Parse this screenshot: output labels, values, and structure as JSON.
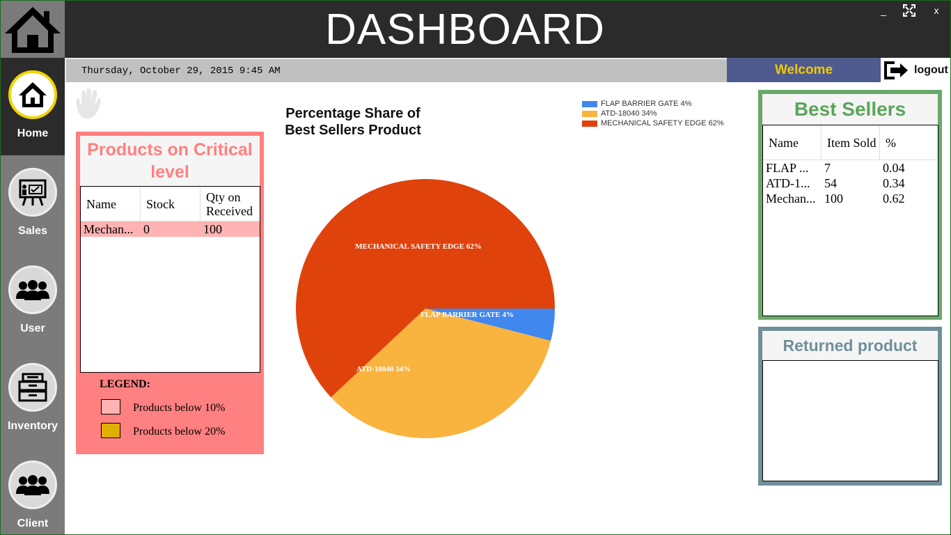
{
  "window": {
    "title": "DASHBOARD",
    "minimize_label": "_",
    "close_label": "x"
  },
  "datetime": "Thursday, October 29, 2015 9:45 AM",
  "welcome": "Welcome",
  "logout_label": "logout",
  "sidebar": {
    "items": [
      {
        "label": "Home",
        "icon": "home-icon"
      },
      {
        "label": "Sales",
        "icon": "sales-board-icon"
      },
      {
        "label": "User",
        "icon": "users-icon"
      },
      {
        "label": "Inventory",
        "icon": "inventory-cabinet-icon"
      },
      {
        "label": "Client",
        "icon": "clients-icon"
      }
    ]
  },
  "critical": {
    "title": "Products on Critical level",
    "columns": [
      "Name",
      "Stock",
      "Qty on Received"
    ],
    "rows": [
      {
        "name": "Mechan...",
        "stock": "0",
        "qty": "100"
      }
    ],
    "legend_title": "LEGEND:",
    "legend": [
      {
        "label": "Products below 10%",
        "color": "#ffb3b3"
      },
      {
        "label": "Products below 20%",
        "color": "#e0b000"
      }
    ]
  },
  "best_sellers": {
    "title": "Best Sellers",
    "columns": [
      "Name",
      "Item Sold",
      "%"
    ],
    "rows": [
      {
        "name": "FLAP ...",
        "sold": "7",
        "pct": "0.04"
      },
      {
        "name": "ATD-1...",
        "sold": "54",
        "pct": "0.34"
      },
      {
        "name": "Mechan...",
        "sold": "100",
        "pct": "0.62"
      }
    ]
  },
  "returned": {
    "title": "Returned product"
  },
  "colors": {
    "accent_yellow": "#f2d400",
    "critical_panel": "#ff8080",
    "best_panel": "#6aa96a",
    "returned_panel": "#6f8f99",
    "welcome_bg": "#4f5b8f"
  },
  "chart_data": {
    "type": "pie",
    "title": "Percentage Share of Best Sellers Product",
    "slices": [
      {
        "label": "FLAP BARRIER GATE 4%",
        "value": 4,
        "color": "#4088ee"
      },
      {
        "label": "ATD-18040 34%",
        "value": 34,
        "color": "#f9b33f"
      },
      {
        "label": "MECHANICAL SAFETY EDGE 62%",
        "value": 62,
        "color": "#e0420c"
      }
    ],
    "legend_position": "top-right"
  }
}
